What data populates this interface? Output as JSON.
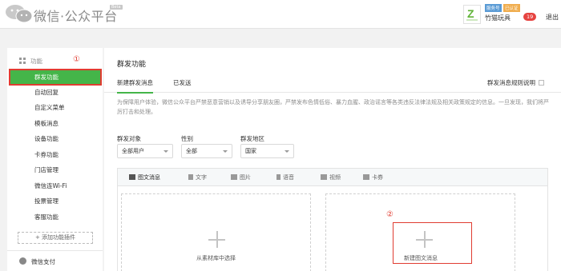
{
  "header": {
    "brand": "微信·公众平台",
    "beta": "Beta",
    "account_type": "服务号",
    "verified": "已认证",
    "account_name": "竹猫玩具",
    "message_count": "19",
    "logout": "退出"
  },
  "sidebar": {
    "section": "功能",
    "marker": "①",
    "items": [
      {
        "label": "群发功能",
        "active": true
      },
      {
        "label": "自动回复"
      },
      {
        "label": "自定义菜单"
      },
      {
        "label": "模板消息"
      },
      {
        "label": "设备功能"
      },
      {
        "label": "卡券功能"
      },
      {
        "label": "门店管理"
      },
      {
        "label": "微信连Wi-Fi"
      },
      {
        "label": "投票管理"
      },
      {
        "label": "客服功能"
      }
    ],
    "add_plugin": "+ 添加功能插件",
    "pay": "微信支付"
  },
  "main": {
    "title": "群发功能",
    "tabs": [
      {
        "label": "新建群发消息",
        "active": true
      },
      {
        "label": "已发送"
      }
    ],
    "rules_link": "群发消息规则说明",
    "notice": "为保障用户体验，微信公众平台严禁恶意营销以及诱导分享朋友圈，严禁发布色情低俗、暴力血腥、政治谣言等各类违反法律法规及相关政策规定的信息。一旦发现，我们将严厉打击和处理。",
    "filters": {
      "target_label": "群发对象",
      "target_value": "全部用户",
      "gender_label": "性别",
      "gender_value": "全部",
      "region_label": "群发地区",
      "region_value": "国家"
    },
    "toolbar": [
      "图文消息",
      "文字",
      "图片",
      "语音",
      "视频",
      "卡券"
    ],
    "slot_library": "从素材库中选择",
    "slot_new": "新建图文消息",
    "marker2": "②"
  },
  "colors": {
    "accent": "#44b549",
    "annotation": "#e03c31"
  }
}
